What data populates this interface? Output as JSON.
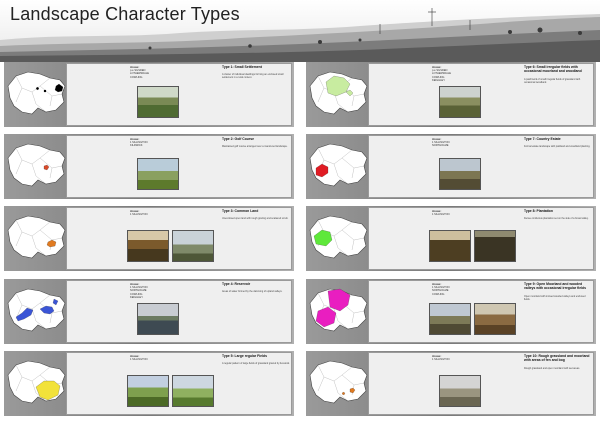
{
  "page": {
    "title": "Landscape Character Types"
  },
  "colors": {
    "background": "#ffffff",
    "card": "#efefef",
    "strip": "#8a8a8a"
  },
  "panels": [
    {
      "id": "type1",
      "title": "Type 1: Small Settlement",
      "areas_label": "Areas:",
      "areas": "p.e SILSDEN\nLOTHERSDALE\nCOWLING",
      "description": "A cluster of individual dwellings forming an enclosed small settlement in a rural context.",
      "highlight_color": "#000000",
      "photos": 1
    },
    {
      "id": "type2",
      "title": "Type 2: Golf Course",
      "areas_label": "Areas:",
      "areas": "1 SILLINGTON\nKILDWICK",
      "description": "Maintained golf course arranged over a manicured landscape.",
      "highlight_color": "#d94a2a",
      "photos": 1
    },
    {
      "id": "type3",
      "title": "Type 3: Common Land",
      "areas_label": "Areas:",
      "areas": "1 SILLINGTON",
      "description": "Unenclosed open land with rough grazing and scattered scrub.",
      "highlight_color": "#e07a20",
      "photos": 2
    },
    {
      "id": "type4",
      "title": "Type 4: Reservoir",
      "areas_label": "Areas:",
      "areas": "1 SILLINGTON\nNORTHOLME\nCOWLING\nKEIGHLEY",
      "description": "Areas of water formed by the damming of upland valleys.",
      "highlight_color": "#3b55d6",
      "photos": 1
    },
    {
      "id": "type5",
      "title": "Type 5: Large regular Fields",
      "areas_label": "Areas:",
      "areas": "1 SILLINGTON",
      "description": "A regular pattern of large fields of grassland grazed by livestock.",
      "highlight_color": "#f2e23a",
      "photos": 2
    },
    {
      "id": "type6",
      "title": "Type 6: Small irregular fields with occasional moorland and woodland",
      "areas_label": "Areas:",
      "areas": "p.e SILSDEN\nLOTHERSDALE\nCOWLING\nKEIGHLEY",
      "description": "A patchwork of small irregular fields of grassland with occasional woodland.",
      "highlight_color": "#c8eca0",
      "photos": 1
    },
    {
      "id": "type7",
      "title": "Type 7: Country Estate",
      "areas_label": "Areas:",
      "areas": "1 SILLINGTON\nNORTHOLME",
      "description": "Formal estate landscape with parkland and woodland planting.",
      "highlight_color": "#e01c24",
      "photos": 1
    },
    {
      "id": "type8",
      "title": "Type 8: Plantation",
      "areas_label": "Areas:",
      "areas": "1 SILLINGTON",
      "description": "Dense coniferous plantation set on the side of a broad valley.",
      "highlight_color": "#5ee83a",
      "photos": 2
    },
    {
      "id": "type9",
      "title": "Type 9: Open Moorland and wooded valleys with occasional irregular fields",
      "areas_label": "Areas:",
      "areas": "1 SILLINGTON\nNORTHOLME\nCOWLING",
      "description": "Open moorland with incised wooded valleys and enclosed fields.",
      "highlight_color": "#e91ec0",
      "photos": 2
    },
    {
      "id": "type10",
      "title": "Type 10: Rough grassland and moorland with areas of fen and bog",
      "areas_label": "Areas:",
      "areas": "1 SILLINGTON",
      "description": "Rough grassland and open moorland with wet areas.",
      "highlight_color": "#e07a20",
      "photos": 1
    }
  ]
}
